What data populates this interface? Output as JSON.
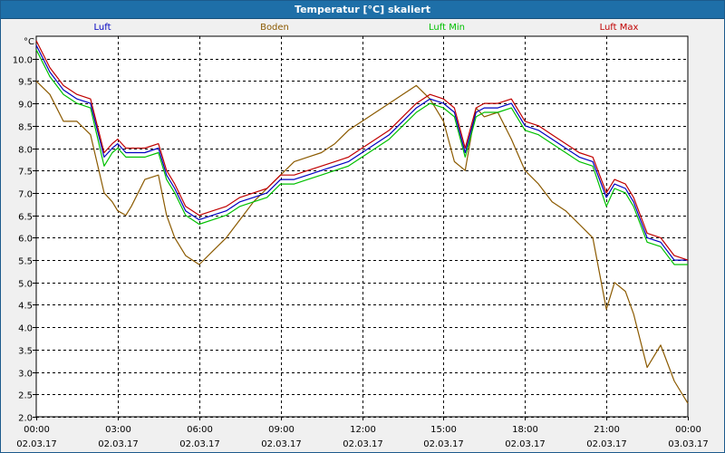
{
  "window": {
    "title": "Temperatur [°C] skaliert"
  },
  "chart_data": {
    "type": "line",
    "title": "Temperatur [°C] skaliert",
    "ylabel": "°C",
    "xlabel": "",
    "ylim": [
      2.0,
      10.5
    ],
    "xlim": [
      0,
      24
    ],
    "grid": true,
    "legend_placement": "top",
    "y_ticks": [
      2.0,
      2.5,
      3.0,
      3.5,
      4.0,
      4.5,
      5.0,
      5.5,
      6.0,
      6.5,
      7.0,
      7.5,
      8.0,
      8.5,
      9.0,
      9.5,
      10.0
    ],
    "y_tick_labels": [
      "2.0",
      "2.5",
      "3.0",
      "3.5",
      "4.0",
      "4.5",
      "5.0",
      "5.5",
      "6.0",
      "6.5",
      "7.0",
      "7.5",
      "8.0",
      "8.5",
      "9.0",
      "9.5",
      "10.0"
    ],
    "x_ticks": [
      0,
      3,
      6,
      9,
      12,
      15,
      18,
      21,
      24
    ],
    "x_tick_labels": [
      {
        "time": "00:00",
        "date": "02.03.17"
      },
      {
        "time": "03:00",
        "date": "02.03.17"
      },
      {
        "time": "06:00",
        "date": "02.03.17"
      },
      {
        "time": "09:00",
        "date": "02.03.17"
      },
      {
        "time": "12:00",
        "date": "02.03.17"
      },
      {
        "time": "15:00",
        "date": "02.03.17"
      },
      {
        "time": "18:00",
        "date": "02.03.17"
      },
      {
        "time": "21:00",
        "date": "02.03.17"
      },
      {
        "time": "00:00",
        "date": "03.03.17"
      }
    ],
    "x": [
      0,
      0.5,
      1,
      1.5,
      2,
      2.5,
      2.8,
      3,
      3.3,
      3.5,
      4,
      4.5,
      4.8,
      5.1,
      5.5,
      6,
      6.5,
      7,
      7.5,
      8,
      8.5,
      9,
      9.5,
      10,
      10.5,
      11,
      11.5,
      12,
      12.5,
      13,
      13.5,
      14,
      14.5,
      15,
      15.4,
      15.8,
      16.2,
      16.5,
      17,
      17.5,
      18,
      18.5,
      19,
      19.5,
      20,
      20.5,
      21,
      21.3,
      21.7,
      22,
      22.5,
      23,
      23.5,
      24
    ],
    "series": [
      {
        "name": "Luft",
        "color": "#0000c0",
        "values": [
          10.3,
          9.7,
          9.3,
          9.1,
          9.0,
          7.8,
          8.0,
          8.1,
          7.9,
          7.9,
          7.9,
          8.0,
          7.4,
          7.1,
          6.6,
          6.4,
          6.5,
          6.6,
          6.8,
          6.9,
          7.0,
          7.3,
          7.3,
          7.4,
          7.5,
          7.6,
          7.7,
          7.9,
          8.1,
          8.3,
          8.6,
          8.9,
          9.1,
          9.0,
          8.8,
          7.9,
          8.8,
          8.9,
          8.9,
          9.0,
          8.5,
          8.4,
          8.2,
          8.0,
          7.8,
          7.7,
          6.9,
          7.2,
          7.1,
          6.8,
          6.0,
          5.9,
          5.5,
          5.5
        ]
      },
      {
        "name": "Boden",
        "color": "#8b5a00",
        "values": [
          9.5,
          9.2,
          8.6,
          8.6,
          8.3,
          7.0,
          6.8,
          6.6,
          6.5,
          6.7,
          7.3,
          7.4,
          6.5,
          6.0,
          5.6,
          5.4,
          5.7,
          6.0,
          6.4,
          6.8,
          7.1,
          7.4,
          7.7,
          7.8,
          7.9,
          8.1,
          8.4,
          8.6,
          8.8,
          9.0,
          9.2,
          9.4,
          9.1,
          8.6,
          7.7,
          7.5,
          8.9,
          8.7,
          8.8,
          8.2,
          7.5,
          7.2,
          6.8,
          6.6,
          6.3,
          6.0,
          4.4,
          5.0,
          4.8,
          4.3,
          3.1,
          3.6,
          2.8,
          2.3
        ]
      },
      {
        "name": "Luft Min",
        "color": "#00c000",
        "values": [
          10.2,
          9.6,
          9.2,
          9.0,
          8.9,
          7.6,
          7.9,
          8.0,
          7.8,
          7.8,
          7.8,
          7.9,
          7.3,
          7.0,
          6.5,
          6.3,
          6.4,
          6.5,
          6.7,
          6.8,
          6.9,
          7.2,
          7.2,
          7.3,
          7.4,
          7.5,
          7.6,
          7.8,
          8.0,
          8.2,
          8.5,
          8.8,
          9.0,
          8.9,
          8.7,
          7.8,
          8.7,
          8.8,
          8.8,
          8.9,
          8.4,
          8.3,
          8.1,
          7.9,
          7.7,
          7.6,
          6.7,
          7.1,
          7.0,
          6.7,
          5.9,
          5.8,
          5.4,
          5.4
        ]
      },
      {
        "name": "Luft Max",
        "color": "#c00000",
        "values": [
          10.4,
          9.8,
          9.4,
          9.2,
          9.1,
          7.9,
          8.1,
          8.2,
          8.0,
          8.0,
          8.0,
          8.1,
          7.5,
          7.2,
          6.7,
          6.5,
          6.6,
          6.7,
          6.9,
          7.0,
          7.1,
          7.4,
          7.4,
          7.5,
          7.6,
          7.7,
          7.8,
          8.0,
          8.2,
          8.4,
          8.7,
          9.0,
          9.2,
          9.1,
          8.9,
          8.0,
          8.9,
          9.0,
          9.0,
          9.1,
          8.6,
          8.5,
          8.3,
          8.1,
          7.9,
          7.8,
          7.0,
          7.3,
          7.2,
          6.9,
          6.1,
          6.0,
          5.6,
          5.5
        ]
      }
    ]
  }
}
